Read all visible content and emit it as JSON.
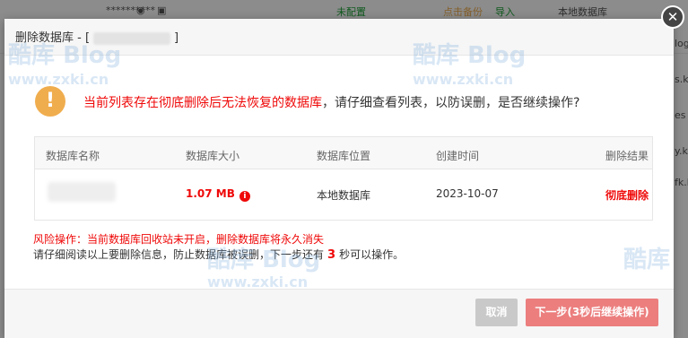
{
  "background": {
    "masked_value": "**********",
    "status_unconfigured": "未配置",
    "backup_link": "点击备份",
    "import_link": "导入",
    "location": "本地数据库",
    "right_fragments": [
      "log",
      "s.kt",
      "es",
      "y.kt",
      "fk.kt"
    ]
  },
  "dialog": {
    "title_prefix": "删除数据库 - [",
    "title_suffix": "]",
    "warning": {
      "red_part": "当前列表存在彻底删除后无法恢复的数据库",
      "normal_part": "，请仔细查看列表，以防误删，是否继续操作?"
    },
    "table": {
      "headers": [
        "数据库名称",
        "数据库大小",
        "数据库位置",
        "创建时间",
        "删除结果"
      ],
      "rows": [
        {
          "size": "1.07 MB",
          "location": "本地数据库",
          "created": "2023-10-07",
          "result": "彻底删除"
        }
      ]
    },
    "risk_text": "风险操作：当前数据库回收站未开启，删除数据库将永久消失",
    "notice": {
      "before": "请仔细阅读以上要删除信息，防止数据库被误删，下一步还有",
      "seconds": "3",
      "after": "秒可以操作。"
    },
    "buttons": {
      "cancel": "取消",
      "next": "下一步(3秒后继续操作)"
    },
    "close_symbol": "✕"
  },
  "watermark": {
    "brand": "酷库",
    "blog": "Blog",
    "url": "www.zxki.cn"
  },
  "colors": {
    "danger": "#ef0808",
    "warning_icon": "#f0ad4e",
    "next_button": "#ec7e7e",
    "cancel_button": "#c9c9c9"
  }
}
